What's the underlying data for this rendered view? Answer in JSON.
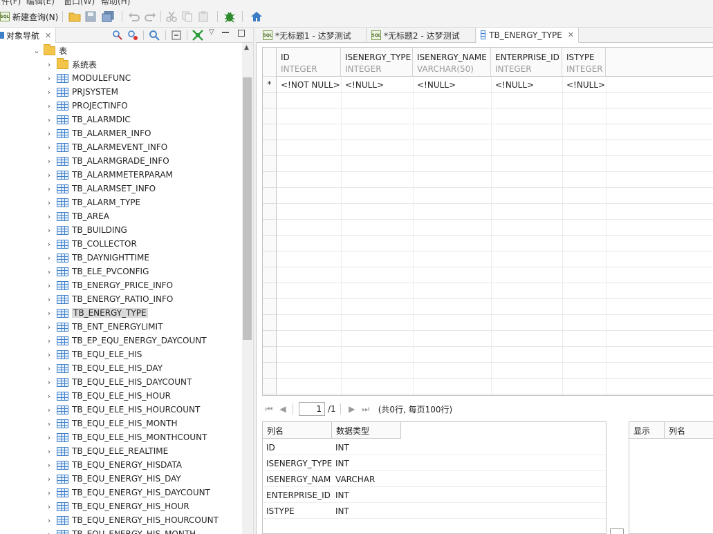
{
  "menubar": {
    "items": [
      "件(F)",
      "编辑(E)",
      "窗口(W)",
      "帮助(H)"
    ]
  },
  "toolbar": {
    "new_query_label": "新建查询(N)"
  },
  "navigator": {
    "tab_label": "对象导航",
    "root_label": "表",
    "items": [
      {
        "label": "系统表",
        "type": "folder"
      },
      {
        "label": "MODULEFUNC",
        "type": "table"
      },
      {
        "label": "PRJSYSTEM",
        "type": "table"
      },
      {
        "label": "PROJECTINFO",
        "type": "table"
      },
      {
        "label": "TB_ALARMDIC",
        "type": "table"
      },
      {
        "label": "TB_ALARMER_INFO",
        "type": "table"
      },
      {
        "label": "TB_ALARMEVENT_INFO",
        "type": "table"
      },
      {
        "label": "TB_ALARMGRADE_INFO",
        "type": "table"
      },
      {
        "label": "TB_ALARMMETERPARAM",
        "type": "table"
      },
      {
        "label": "TB_ALARMSET_INFO",
        "type": "table"
      },
      {
        "label": "TB_ALARM_TYPE",
        "type": "table"
      },
      {
        "label": "TB_AREA",
        "type": "table"
      },
      {
        "label": "TB_BUILDING",
        "type": "table"
      },
      {
        "label": "TB_COLLECTOR",
        "type": "table"
      },
      {
        "label": "TB_DAYNIGHTTIME",
        "type": "table"
      },
      {
        "label": "TB_ELE_PVCONFIG",
        "type": "table"
      },
      {
        "label": "TB_ENERGY_PRICE_INFO",
        "type": "table"
      },
      {
        "label": "TB_ENERGY_RATIO_INFO",
        "type": "table"
      },
      {
        "label": "TB_ENERGY_TYPE",
        "type": "table",
        "selected": true
      },
      {
        "label": "TB_ENT_ENERGYLIMIT",
        "type": "table"
      },
      {
        "label": "TB_EP_EQU_ENERGY_DAYCOUNT",
        "type": "table"
      },
      {
        "label": "TB_EQU_ELE_HIS",
        "type": "table"
      },
      {
        "label": "TB_EQU_ELE_HIS_DAY",
        "type": "table"
      },
      {
        "label": "TB_EQU_ELE_HIS_DAYCOUNT",
        "type": "table"
      },
      {
        "label": "TB_EQU_ELE_HIS_HOUR",
        "type": "table"
      },
      {
        "label": "TB_EQU_ELE_HIS_HOURCOUNT",
        "type": "table"
      },
      {
        "label": "TB_EQU_ELE_HIS_MONTH",
        "type": "table"
      },
      {
        "label": "TB_EQU_ELE_HIS_MONTHCOUNT",
        "type": "table"
      },
      {
        "label": "TB_EQU_ELE_REALTIME",
        "type": "table"
      },
      {
        "label": "TB_EQU_ENERGY_HISDATA",
        "type": "table"
      },
      {
        "label": "TB_EQU_ENERGY_HIS_DAY",
        "type": "table"
      },
      {
        "label": "TB_EQU_ENERGY_HIS_DAYCOUNT",
        "type": "table"
      },
      {
        "label": "TB_EQU_ENERGY_HIS_HOUR",
        "type": "table"
      },
      {
        "label": "TB_EQU_ENERGY_HIS_HOURCOUNT",
        "type": "table"
      },
      {
        "label": "TB_EQU_ENERGY_HIS_MONTH",
        "type": "table"
      }
    ]
  },
  "editor": {
    "tabs": [
      {
        "label": "*无标题1 - 达梦测试",
        "icon": "sql-icon"
      },
      {
        "label": "*无标题2 - 达梦测试",
        "icon": "sql-icon"
      },
      {
        "label": "TB_ENERGY_TYPE",
        "icon": "table-icon",
        "active": true
      }
    ],
    "grid": {
      "columns": [
        {
          "name": "ID",
          "type": "INTEGER"
        },
        {
          "name": "ISENERGY_TYPE",
          "type": "INTEGER"
        },
        {
          "name": "ISENERGY_NAME",
          "type": "VARCHAR(50)"
        },
        {
          "name": "ENTERPRISE_ID",
          "type": "INTEGER"
        },
        {
          "name": "ISTYPE",
          "type": "INTEGER"
        }
      ],
      "new_row_marker": "*",
      "new_row_values": [
        "<!NOT NULL>",
        "<!NULL>",
        "<!NULL>",
        "<!NULL>",
        "<!NULL>"
      ]
    },
    "pager": {
      "page_value": "1",
      "total_pages": "/1",
      "summary": "(共0行, 每页100行)"
    },
    "column_panel": {
      "headers": [
        "列名",
        "数据类型"
      ],
      "rows": [
        [
          "ID",
          "INT"
        ],
        [
          "ISENERGY_TYPE",
          "INT"
        ],
        [
          "ISENERGY_NAM",
          "VARCHAR"
        ],
        [
          "ENTERPRISE_ID",
          "INT"
        ],
        [
          "ISTYPE",
          "INT"
        ]
      ]
    },
    "right_panel": {
      "headers": [
        "显示",
        "列名"
      ]
    }
  }
}
